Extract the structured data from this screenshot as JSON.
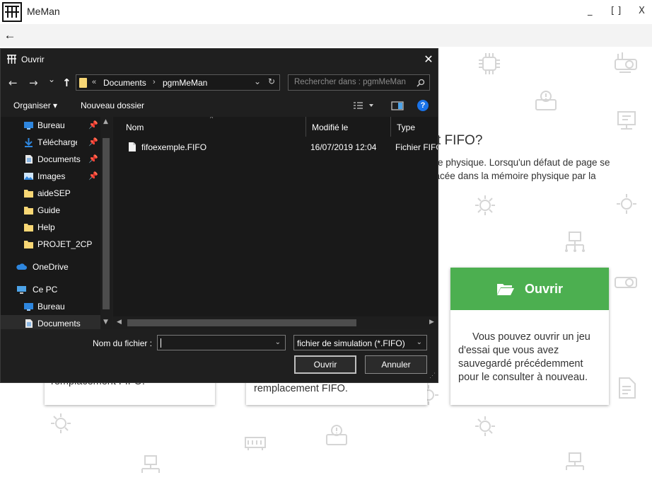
{
  "app": {
    "title": "MeMan",
    "minimize_glyph": "_",
    "maximize_glyph": "[ ]",
    "close_glyph": "X",
    "back_glyph": "←"
  },
  "content": {
    "heading": "t FIFO?",
    "paragraph_line1": "oire physique. Lorsqu'un défaut de page se",
    "paragraph_line2": "placée dans la mémoire physique par la",
    "card_left_text": "remplacement FIFO.",
    "card_mid_text": "remplacement FIFO.",
    "open_card": {
      "title": "Ouvrir",
      "body": "Vous pouvez ouvrir un jeu d'essai que vous avez sauvegardé précédemment pour le consulter à nouveau.",
      "accent": "#4caf50"
    }
  },
  "dialog": {
    "title": "Ouvrir",
    "close_glyph": "✕",
    "nav": {
      "back": "←",
      "forward": "→",
      "history": "⌄",
      "up": "↑"
    },
    "breadcrumb": {
      "overflow": "«",
      "parts": [
        "Documents",
        "pgmMeMan"
      ],
      "sep": "›"
    },
    "refresh_glyph": "↻",
    "search_placeholder": "Rechercher dans : pgmMeMan",
    "toolbar": {
      "organize": "Organiser ▾",
      "new_folder": "Nouveau dossier",
      "help": "?"
    },
    "nav_items": [
      {
        "label": "Bureau",
        "icon": "desktop-icon",
        "pinned": true
      },
      {
        "label": "Téléchargements",
        "icon": "download-icon",
        "pinned": true
      },
      {
        "label": "Documents",
        "icon": "document-icon",
        "pinned": true
      },
      {
        "label": "Images",
        "icon": "image-icon",
        "pinned": true
      },
      {
        "label": "aideSEP",
        "icon": "folder-icon",
        "pinned": false
      },
      {
        "label": "Guide",
        "icon": "folder-icon",
        "pinned": false
      },
      {
        "label": "Help",
        "icon": "folder-icon",
        "pinned": false
      },
      {
        "label": "PROJET_2CP",
        "icon": "folder-icon",
        "pinned": false
      },
      {
        "label": "OneDrive",
        "icon": "cloud-icon",
        "pinned": false
      },
      {
        "label": "Ce PC",
        "icon": "computer-icon",
        "pinned": false
      },
      {
        "label": "Bureau",
        "icon": "desktop-icon",
        "pinned": false
      },
      {
        "label": "Documents",
        "icon": "document-icon",
        "pinned": false
      }
    ],
    "pin_glyph": "📌",
    "columns": {
      "name": "Nom",
      "modified": "Modifié le",
      "type": "Type"
    },
    "files": [
      {
        "name": "fifoexemple.FIFO",
        "modified": "16/07/2019 12:04",
        "type": "Fichier FIFO"
      }
    ],
    "filename_label": "Nom du fichier :",
    "filename_value": "",
    "filter": "fichier de simulation (*.FIFO)",
    "open_button": "Ouvrir",
    "cancel_button": "Annuler"
  }
}
